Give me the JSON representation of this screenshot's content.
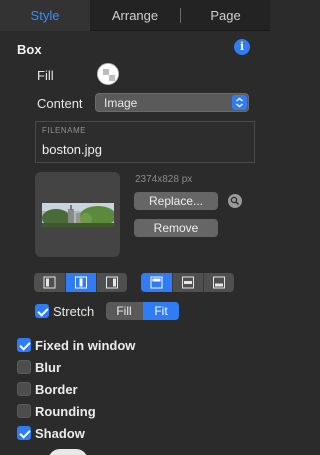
{
  "tabs": [
    {
      "label": "Style",
      "active": true
    },
    {
      "label": "Arrange",
      "active": false
    },
    {
      "label": "Page",
      "active": false
    }
  ],
  "box": {
    "title": "Box",
    "info_icon": "info-icon",
    "fill_label": "Fill",
    "content_label": "Content",
    "content_value": "Image",
    "filename_caption": "FILENAME",
    "filename": "boston.jpg",
    "image_size": "2374x828 px",
    "replace_label": "Replace...",
    "remove_label": "Remove",
    "stretch_label": "Stretch",
    "stretch_checked": true,
    "fill_option": "Fill",
    "fit_option": "Fit",
    "fit_mode": "Fit"
  },
  "options": [
    {
      "label": "Fixed in window",
      "checked": true
    },
    {
      "label": "Blur",
      "checked": false
    },
    {
      "label": "Border",
      "checked": false
    },
    {
      "label": "Rounding",
      "checked": false
    },
    {
      "label": "Shadow",
      "checked": true
    }
  ],
  "colors": {
    "accent": "#2f7cf6",
    "panel": "#2b2b2b",
    "tabbar": "#232323",
    "control": "#666666"
  }
}
